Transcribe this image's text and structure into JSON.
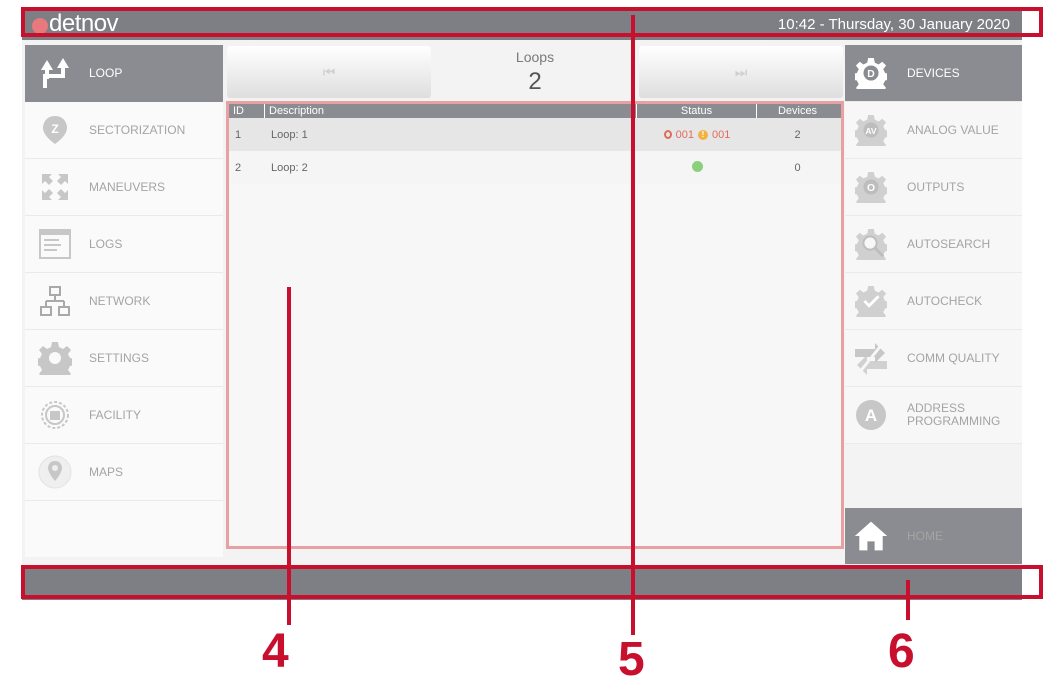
{
  "header": {
    "brand": "detnov",
    "datetime": "10:42  -  Thursday, 30 January 2020"
  },
  "left_menu": [
    {
      "label": "LOOP",
      "icon": "loop-arrows-icon",
      "active": true
    },
    {
      "label": "SECTORIZATION",
      "icon": "sector-pin-icon"
    },
    {
      "label": "MANEUVERS",
      "icon": "maneuvers-arrows-icon"
    },
    {
      "label": "LOGS",
      "icon": "logs-icon"
    },
    {
      "label": "NETWORK",
      "icon": "network-icon"
    },
    {
      "label": "SETTINGS",
      "icon": "settings-gear-icon"
    },
    {
      "label": "FACILITY",
      "icon": "facility-icon"
    },
    {
      "label": "MAPS",
      "icon": "map-pin-icon"
    }
  ],
  "loops": {
    "title": "Loops",
    "count": "2",
    "prev_glyph": "⏮",
    "next_glyph": "⏭"
  },
  "table": {
    "columns": [
      "ID",
      "Description",
      "Status",
      "Devices"
    ],
    "rows": [
      {
        "id": "1",
        "description": "Loop: 1",
        "alarm_count": "001",
        "fault_count": "001",
        "devices": "2"
      },
      {
        "id": "2",
        "description": "Loop: 2",
        "status": "ok",
        "devices": "0"
      }
    ]
  },
  "right_menu": [
    {
      "label": "DEVICES",
      "icon": "devices-gear-icon",
      "icon_text": "D",
      "active": true
    },
    {
      "label": "ANALOG VALUE",
      "icon": "analog-value-icon",
      "icon_text": "AV"
    },
    {
      "label": "OUTPUTS",
      "icon": "outputs-icon",
      "icon_text": "O"
    },
    {
      "label": "AUTOSEARCH",
      "icon": "autosearch-icon"
    },
    {
      "label": "AUTOCHECK",
      "icon": "autocheck-icon"
    },
    {
      "label": "COMM QUALITY",
      "icon": "comm-quality-icon"
    },
    {
      "label": "ADDRESS PROGRAMMING",
      "icon": "address-programming-icon",
      "icon_text": "A"
    }
  ],
  "home": {
    "label": "HOME"
  },
  "annotations": {
    "callout_4": "4",
    "callout_5": "5",
    "callout_6": "6"
  },
  "colors": {
    "annotation": "#c8102e",
    "header": "#7d7f85",
    "active": "#8a8c91",
    "alarm": "#e06b5d",
    "fault": "#f0b342",
    "ok": "#8bd17c"
  }
}
